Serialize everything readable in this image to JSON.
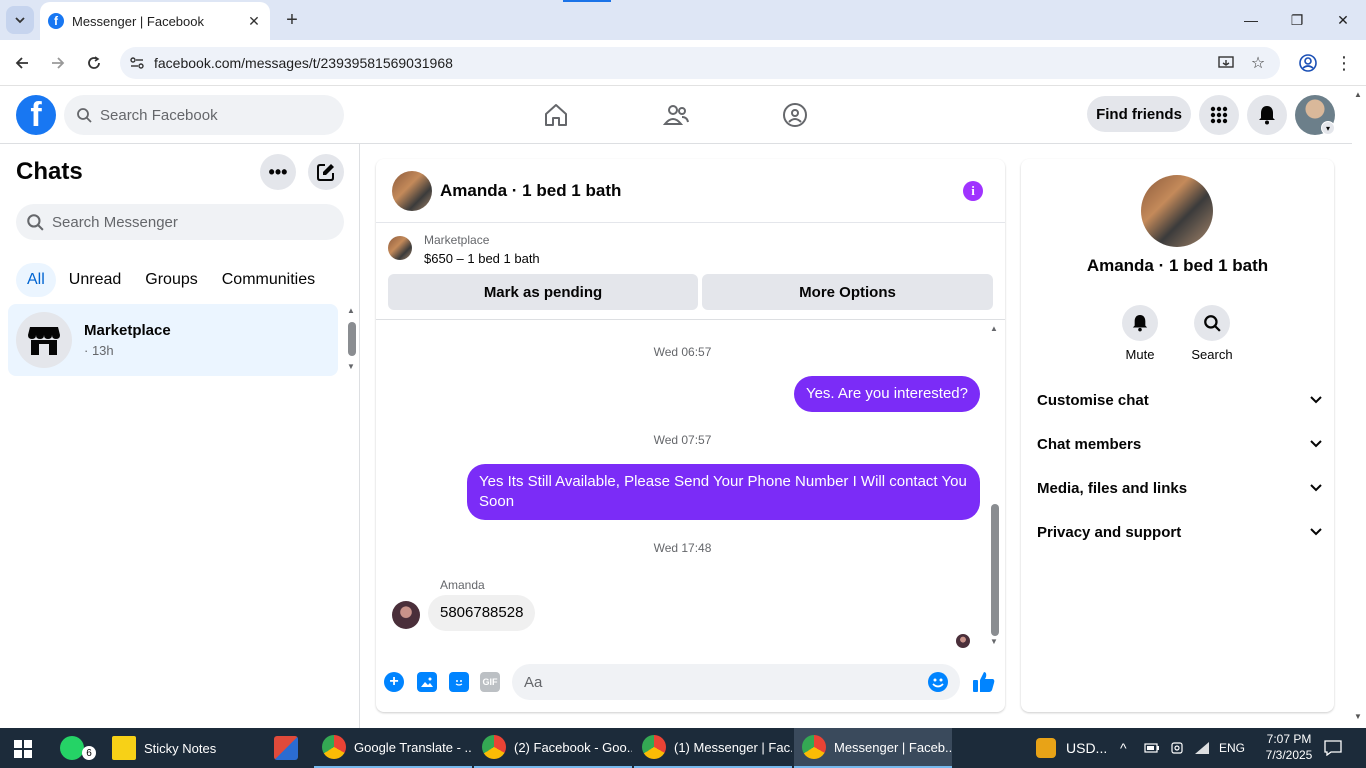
{
  "browser": {
    "tab_title": "Messenger | Facebook",
    "url": "facebook.com/messages/t/23939581569031968"
  },
  "fb_header": {
    "search_placeholder": "Search Facebook",
    "find_friends": "Find friends"
  },
  "chats": {
    "title": "Chats",
    "search_placeholder": "Search Messenger",
    "filters": [
      "All",
      "Unread",
      "Groups",
      "Communities"
    ],
    "active_filter": "All",
    "items": [
      {
        "name": "Marketplace",
        "meta": "· 13h"
      }
    ]
  },
  "conversation": {
    "title": "Amanda · 1 bed 1 bath",
    "marketplace": {
      "label": "Marketplace",
      "price_line": "$650 – 1 bed 1 bath",
      "mark_pending": "Mark as pending",
      "more_options": "More Options"
    },
    "messages": [
      {
        "type": "timestamp",
        "text": "Wed 06:57"
      },
      {
        "type": "outgoing",
        "text": "Yes. Are you interested?"
      },
      {
        "type": "timestamp",
        "text": "Wed 07:57"
      },
      {
        "type": "outgoing",
        "text": "Yes Its Still Available, Please Send Your Phone Number I Will contact You Soon"
      },
      {
        "type": "timestamp",
        "text": "Wed 17:48"
      },
      {
        "type": "incoming",
        "sender": "Amanda",
        "text": "5806788528"
      }
    ],
    "composer_placeholder": "Aa",
    "gif_label": "GIF"
  },
  "info_panel": {
    "name": "Amanda · 1 bed 1 bath",
    "actions": [
      {
        "label": "Mute",
        "icon": "bell-icon"
      },
      {
        "label": "Search",
        "icon": "search-icon"
      }
    ],
    "sections": [
      "Customise chat",
      "Chat members",
      "Media, files and links",
      "Privacy and support"
    ]
  },
  "taskbar": {
    "items": [
      {
        "label": "",
        "badge": "6",
        "icon": "whatsapp-icon"
      },
      {
        "label": "Sticky Notes",
        "icon": "sticky-notes-icon"
      },
      {
        "label": "",
        "icon": "snipping-tool-icon"
      },
      {
        "label": "Google Translate - ...",
        "icon": "chrome-icon"
      },
      {
        "label": "(2) Facebook - Goo...",
        "icon": "chrome-icon"
      },
      {
        "label": "(1) Messenger | Fac...",
        "icon": "chrome-icon"
      },
      {
        "label": "Messenger | Faceb...",
        "icon": "chrome-icon"
      }
    ],
    "tray_currency": "USD...",
    "language": "ENG",
    "time": "7:07 PM",
    "date": "7/3/2025"
  },
  "colors": {
    "fb_blue": "#1877f2",
    "outgoing_bubble": "#7b2cf7",
    "messenger_blue": "#0084ff",
    "taskbar": "#1c2b3a"
  }
}
